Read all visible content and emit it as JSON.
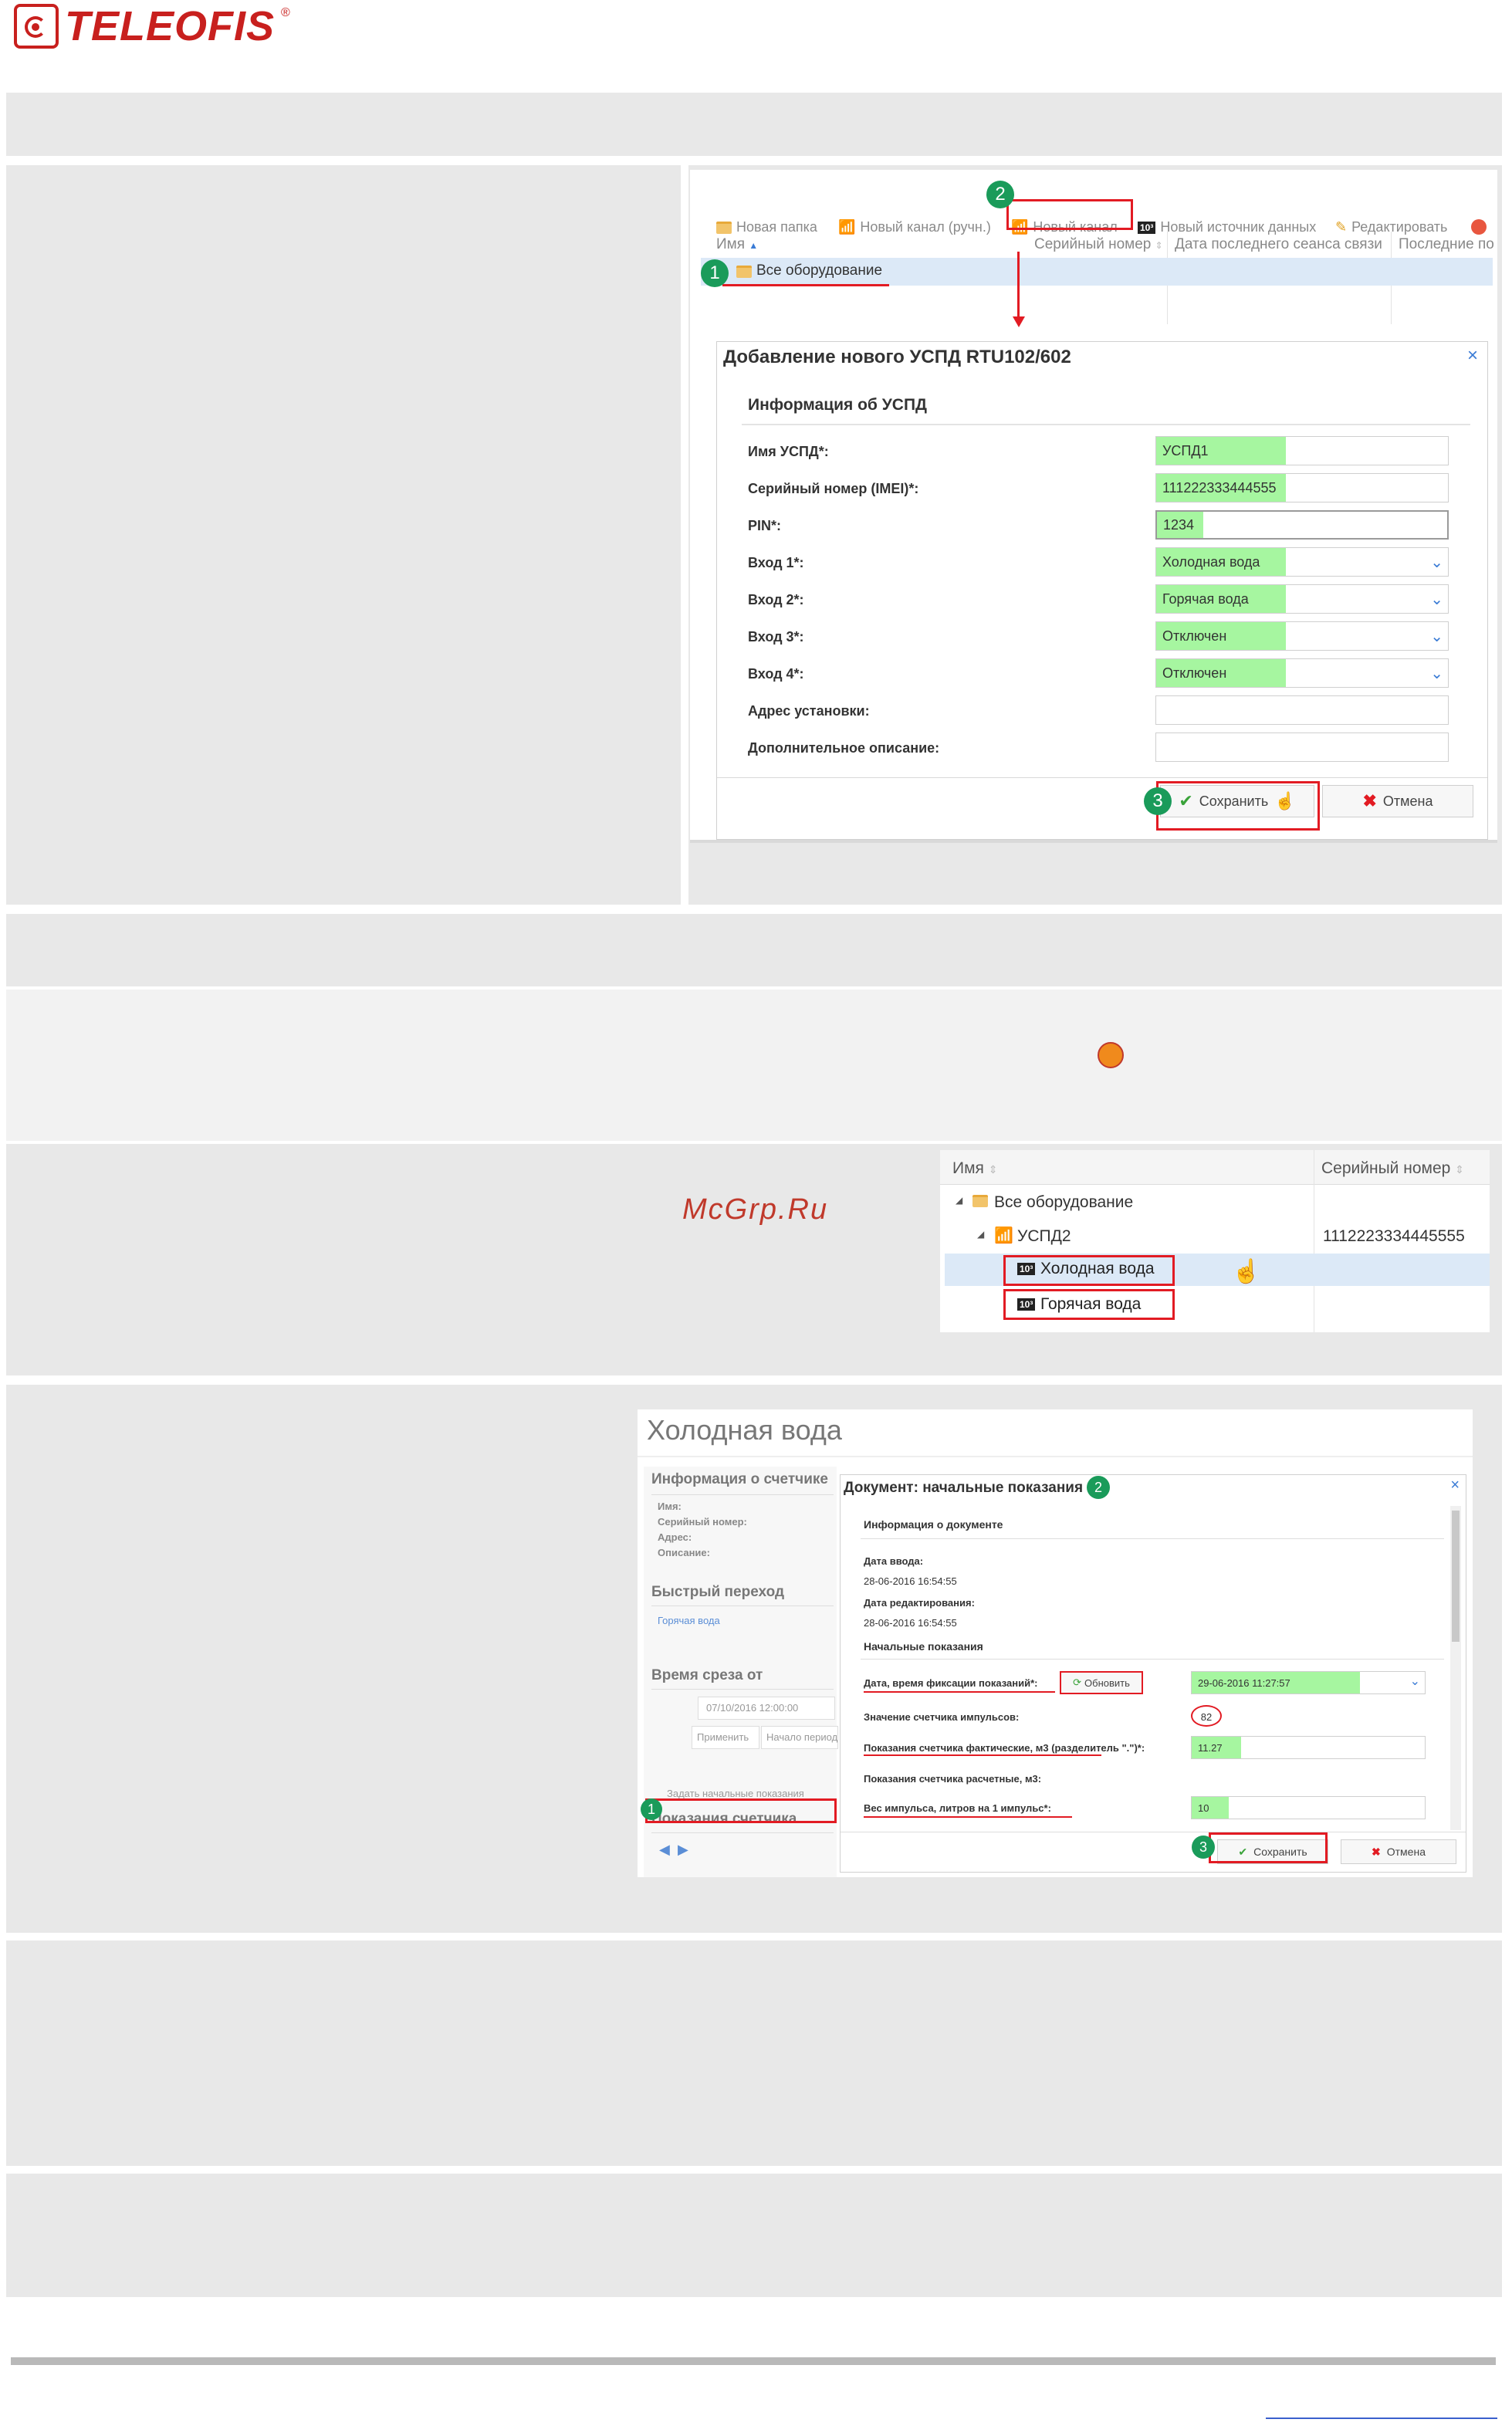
{
  "logo": {
    "text": "TELEOFIS",
    "reg": "®"
  },
  "watermark": "McGrp.Ru",
  "shot1": {
    "toolbar": {
      "new_folder": "Новая папка",
      "new_channel_manual": "Новый канал (ручн.)",
      "new_channel": "Новый канал",
      "new_source": "Новый источник данных",
      "edit": "Редактировать"
    },
    "columns": {
      "name": "Имя",
      "serial": "Серийный номер",
      "last_session": "Дата последнего сеанса связи",
      "last": "Последние по"
    },
    "tree_root": "Все оборудование",
    "dialog": {
      "title": "Добавление нового УСПД RTU102/602",
      "close": "×",
      "section": "Информация об УСПД",
      "fields": [
        {
          "label": "Имя УСПД*:",
          "value": "УСПД1"
        },
        {
          "label": "Серийный номер (IMEI)*:",
          "value": "111222333444555"
        },
        {
          "label": "PIN*:",
          "value": "1234"
        },
        {
          "label": "Вход 1*:",
          "value": "Холодная вода"
        },
        {
          "label": "Вход 2*:",
          "value": "Горячая вода"
        },
        {
          "label": "Вход 3*:",
          "value": "Отключен"
        },
        {
          "label": "Вход 4*:",
          "value": "Отключен"
        },
        {
          "label": "Адрес установки:",
          "value": ""
        },
        {
          "label": "Дополнительное описание:",
          "value": ""
        }
      ],
      "save": "Сохранить",
      "cancel": "Отмена"
    },
    "steps": [
      "1",
      "2",
      "3"
    ]
  },
  "shot2": {
    "columns": {
      "name": "Имя",
      "serial": "Серийный номер"
    },
    "rows": [
      {
        "label": "Все оборудование",
        "serial": ""
      },
      {
        "label": "УСПД2",
        "serial": "1112223334445555"
      },
      {
        "label": "Холодная вода",
        "serial": ""
      },
      {
        "label": "Горячая вода",
        "serial": ""
      }
    ],
    "meter_tag": "10³"
  },
  "shot3": {
    "title": "Холодная вода",
    "left": {
      "info_title": "Информация о счетчике",
      "info_lines": [
        "Имя:",
        "Серийный номер:",
        "Адрес:",
        "Описание:"
      ],
      "quick_title": "Быстрый переход",
      "quick_link": "Горячая вода",
      "slice_title": "Время среза от",
      "slice_value": "07/10/2016 12:00:00",
      "apply": "Применить",
      "period": "Начало период",
      "set_initial": "Задать начальные показания",
      "readings_title": "Показания счетчика"
    },
    "dialog": {
      "title": "Документ: начальные показания",
      "close": "×",
      "doc_section": "Информация о документе",
      "entry_label": "Дата ввода:",
      "entry_value": "28-06-2016 16:54:55",
      "edit_label": "Дата редактирования:",
      "edit_value": "28-06-2016 16:54:55",
      "initial_section": "Начальные показания",
      "fix_label": "Дата, время фиксации показаний*:",
      "refresh": "Обновить",
      "fix_value": "29-06-2016 11:27:57",
      "pulse_label": "Значение счетчика импульсов:",
      "pulse_value": "82",
      "actual_label": "Показания счетчика фактические, м3 (разделитель \".\")*:",
      "actual_value": "11.27",
      "calc_label": "Показания счетчика расчетные, м3:",
      "weight_label": "Вес импульса, литров на 1 импульс*:",
      "weight_value": "10",
      "save": "Сохранить",
      "cancel": "Отмена"
    },
    "steps": [
      "1",
      "2",
      "3"
    ]
  },
  "colors": {
    "step": "#1a9b5a",
    "highlight": "#e21b23",
    "green_field": "#a6f6a0",
    "logo": "#c8201e"
  }
}
